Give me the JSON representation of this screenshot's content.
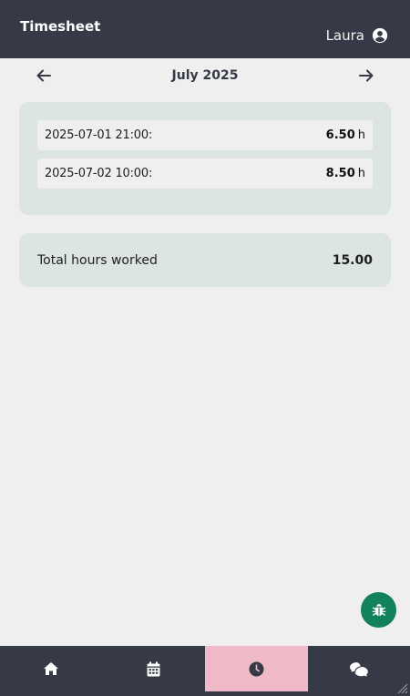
{
  "header": {
    "title": "Timesheet",
    "user_name": "Laura",
    "avatar_icon": "user-circle-icon"
  },
  "month_nav": {
    "label": "July 2025",
    "prev_icon": "arrow-left-icon",
    "next_icon": "arrow-right-icon"
  },
  "entries": [
    {
      "date": "2025-07-01 21:00:",
      "hours": "6.50",
      "unit": "h"
    },
    {
      "date": "2025-07-02 10:00:",
      "hours": "8.50",
      "unit": "h"
    }
  ],
  "total": {
    "label": "Total hours worked",
    "value": "15.00"
  },
  "fab": {
    "icon": "bug-icon",
    "color": "#12825a"
  },
  "bottom_nav": {
    "tabs": [
      {
        "icon": "home-icon",
        "active": false
      },
      {
        "icon": "calendar-icon",
        "active": false
      },
      {
        "icon": "clock-icon",
        "active": true
      },
      {
        "icon": "chat-icon",
        "active": false
      }
    ],
    "active_color": "#f0b9c8",
    "bar_color": "#353a46"
  }
}
